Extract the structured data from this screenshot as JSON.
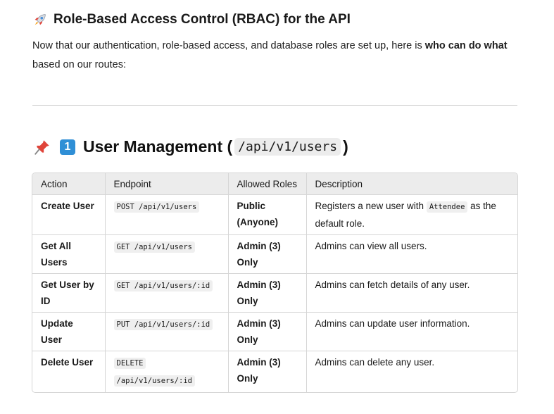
{
  "heading3": {
    "text": "Role-Based Access Control (RBAC) for the API"
  },
  "intro": {
    "prefix": "Now that our authentication, role-based access, and database roles are set up, here is ",
    "bold": "who can do what",
    "suffix": " based on our routes:"
  },
  "section": {
    "number": "1",
    "title_prefix": "User Management (",
    "title_code": "/api/v1/users",
    "title_suffix": ")"
  },
  "table": {
    "headers": [
      "Action",
      "Endpoint",
      "Allowed Roles",
      "Description"
    ],
    "rows": [
      {
        "action": "Create User",
        "endpoint": "POST /api/v1/users",
        "roles": "Public (Anyone)",
        "desc_prefix": "Registers a new user with ",
        "desc_code": "Attendee",
        "desc_suffix": " as the default role."
      },
      {
        "action": "Get All Users",
        "endpoint": "GET /api/v1/users",
        "roles": "Admin (3) Only",
        "desc": "Admins can view all users."
      },
      {
        "action": "Get User by ID",
        "endpoint": "GET /api/v1/users/:id",
        "roles": "Admin (3) Only",
        "desc": "Admins can fetch details of any user."
      },
      {
        "action": "Update User",
        "endpoint": "PUT /api/v1/users/:id",
        "roles": "Admin (3) Only",
        "desc": "Admins can update user information."
      },
      {
        "action": "Delete User",
        "endpoint_line1": "DELETE",
        "endpoint_line2": "/api/v1/users/:id",
        "roles": "Admin (3) Only",
        "desc": "Admins can delete any user."
      }
    ]
  },
  "icons": {
    "heading3": "rocket-icon",
    "section": "pushpin-icon",
    "number_badge": "keycap-1-icon",
    "badge_color": "#2f8fd6"
  }
}
